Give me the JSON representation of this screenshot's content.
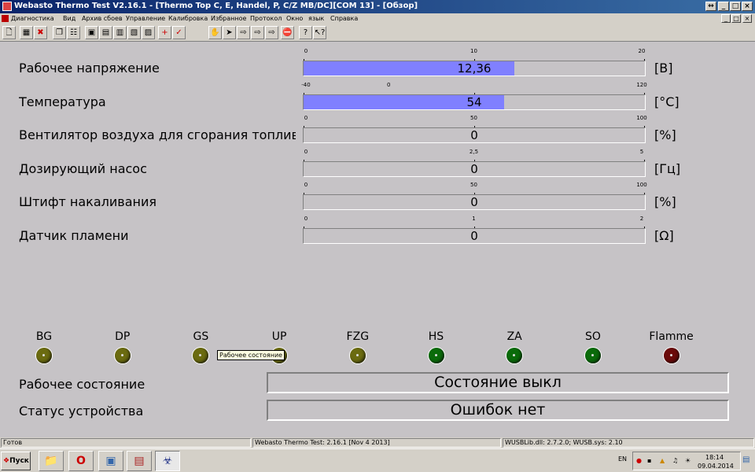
{
  "window": {
    "title": "Webasto Thermo Test V2.16.1 - [Thermo Top C, E, Handel, P, C/Z MB/DC][COM 13] - [Обзор]"
  },
  "menu": [
    "Диагностика",
    "Вид",
    "Архив сбоев",
    "Управление",
    "Калибровка",
    "Избранное",
    "Протокол",
    "Окно",
    "язык",
    "Справка"
  ],
  "toolbar_icons": [
    "new-icon",
    "open-icon",
    "close-doc-icon",
    "copy-icon",
    "paste-icon",
    "view1-icon",
    "view2-icon",
    "view3-icon",
    "view4-icon",
    "view5-icon",
    "add-icon",
    "check-icon",
    "hand-icon",
    "arrow-right-icon",
    "step1-icon",
    "step2-icon",
    "step3-icon",
    "stop-icon",
    "help-icon",
    "context-help-icon"
  ],
  "parameters": [
    {
      "label": "Рабочее напряжение",
      "unit": "[В]",
      "value": "12,36",
      "scale_min": -1,
      "scale_max": -1,
      "ticks": [
        "0",
        "10",
        "20"
      ],
      "fill_fraction": 0.618
    },
    {
      "label": "Температура",
      "unit": "[°C]",
      "value": "54",
      "ticks": [
        "-40",
        "0",
        "120"
      ],
      "fill_fraction": 0.5875
    },
    {
      "label": "Вентилятор воздуха для сгорания топлива",
      "unit": "[%]",
      "value": "0",
      "ticks": [
        "0",
        "50",
        "100"
      ],
      "fill_fraction": 0
    },
    {
      "label": "Дозирующий насос",
      "unit": "[Гц]",
      "value": "0",
      "ticks": [
        "0",
        "2,5",
        "5"
      ],
      "fill_fraction": 0
    },
    {
      "label": "Штифт накаливания",
      "unit": "[%]",
      "value": "0",
      "ticks": [
        "0",
        "50",
        "100"
      ],
      "fill_fraction": 0
    },
    {
      "label": "Датчик пламени",
      "unit": "[Ω]",
      "value": "0",
      "ticks": [
        "0",
        "1",
        "2"
      ],
      "fill_fraction": 0
    }
  ],
  "leds": [
    {
      "label": "BG",
      "color": "#6b6b10"
    },
    {
      "label": "DP",
      "color": "#6b6b10"
    },
    {
      "label": "GS",
      "color": "#6b6b10"
    },
    {
      "label": "UP",
      "color": "#6b6b10"
    },
    {
      "label": "FZG",
      "color": "#6b6b10"
    },
    {
      "label": "HS",
      "color": "#0a6b0a"
    },
    {
      "label": "ZA",
      "color": "#0a6b0a"
    },
    {
      "label": "SO",
      "color": "#0a6b0a"
    },
    {
      "label": "Flamme",
      "color": "#6b0a0a"
    }
  ],
  "status": {
    "operating_label": "Рабочее состояние",
    "operating_value": "Состояние выкл",
    "device_label": "Статус устройства",
    "device_value": "Ошибок нет",
    "tooltip": "Рабочее состояние"
  },
  "statusbar": {
    "ready": "Готов",
    "version": "Webasto Thermo Test: 2.16.1 [Nov  4 2013]",
    "lib": "WUSBLib.dll: 2.7.2.0; WUSB.sys: 2.10"
  },
  "taskbar": {
    "start": "Пуск",
    "lang": "EN",
    "time": "18:14",
    "date": "09.04.2014"
  }
}
